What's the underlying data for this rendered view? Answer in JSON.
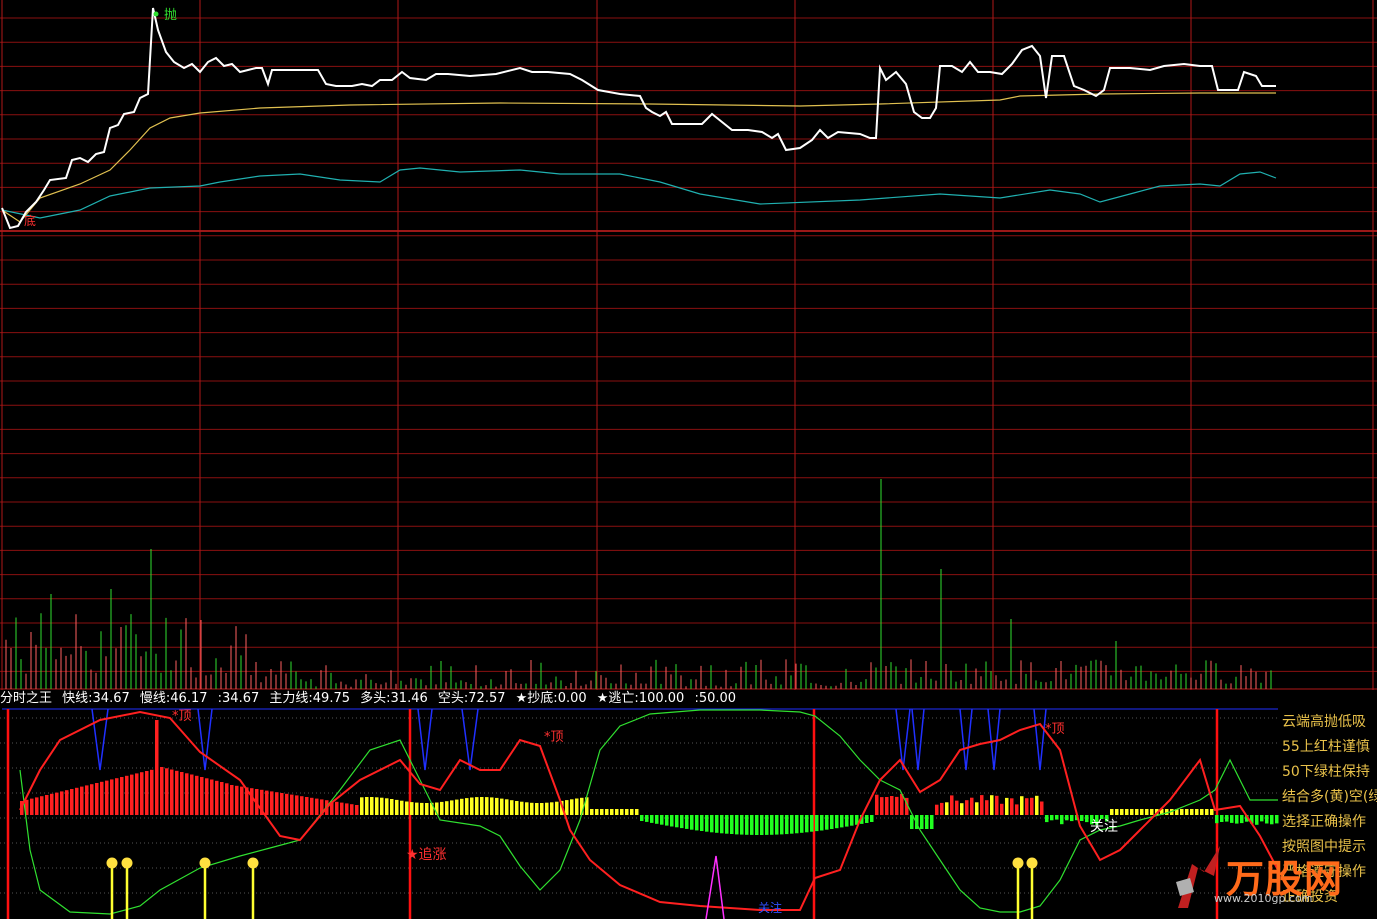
{
  "colors": {
    "background": "#000000",
    "grid": "#8a1010",
    "price_line": "#ffffff",
    "avg_line": "#e0c050",
    "aux_line": "#20b0b0",
    "vol_up": "#ff6060",
    "vol_down": "#30e030",
    "fast_line": "#ff2020",
    "slow_line": "#30e030",
    "top_line": "#2030ff",
    "bar_red": "#ff2020",
    "bar_green": "#20ff20",
    "bar_yellow": "#ffff20",
    "note_text": "#e8c14a"
  },
  "price_chart": {
    "sell_marker": "抛",
    "buy_marker": "底"
  },
  "indicator": {
    "name": "分时之王",
    "fast_label": "快线:34.67",
    "slow_label": "慢线:46.17",
    "extra_label": ":34.67",
    "main_label": "主力线:49.75",
    "long_label": "多头:31.46",
    "short_label": "空头:72.57",
    "bottom_label": "★抄底:0.00",
    "escape_label": "★逃亡:100.00",
    "mid_label": ":50.00"
  },
  "signals": {
    "top1": "*顶",
    "top2": "*顶",
    "top3": "*顶",
    "chase": "★追涨",
    "watch": "关注",
    "bottom": "关注"
  },
  "notes": [
    "云端高抛低吸",
    "55上红柱谨慎",
    "50下绿柱保持",
    "结合多(黄)空(绿",
    "选择正确操作",
    "按照图中提示",
    "严格遵守操作",
    "正确投资"
  ],
  "watermark": {
    "brand": "万股网",
    "url": "www.2010gp.com"
  }
}
